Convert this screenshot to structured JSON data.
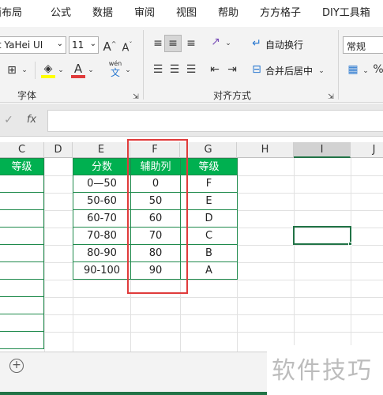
{
  "menu_tabs": [
    "页面布局",
    "公式",
    "数据",
    "审阅",
    "视图",
    "帮助",
    "方方格子",
    "DIY工具箱"
  ],
  "ribbon": {
    "font_name": "Microsoft YaHei UI",
    "font_size": "11",
    "grow_font": "A",
    "shrink_font": "A",
    "font_color_label": "A",
    "wen_label": "wén",
    "wen_char": "文",
    "wrap_text": "自动换行",
    "merge_center": "合并后居中",
    "number_format": "常规",
    "group_font": "字体",
    "group_align": "对齐方式"
  },
  "formula_bar": {
    "fx": "fx",
    "value": ""
  },
  "columns": [
    "C",
    "D",
    "E",
    "F",
    "G",
    "H",
    "I",
    "J"
  ],
  "table": {
    "c_header": "等级",
    "headers": [
      "分数",
      "辅助列",
      "等级"
    ],
    "rows": [
      [
        "0—50",
        "0",
        "F"
      ],
      [
        "50-60",
        "50",
        "E"
      ],
      [
        "60-70",
        "60",
        "D"
      ],
      [
        "70-80",
        "70",
        "C"
      ],
      [
        "80-90",
        "80",
        "B"
      ],
      [
        "90-100",
        "90",
        "A"
      ]
    ]
  },
  "watermark": "软件技巧",
  "colors": {
    "accent_green": "#00b050",
    "highlight_red": "#e03b3b",
    "selection_green": "#217346"
  }
}
